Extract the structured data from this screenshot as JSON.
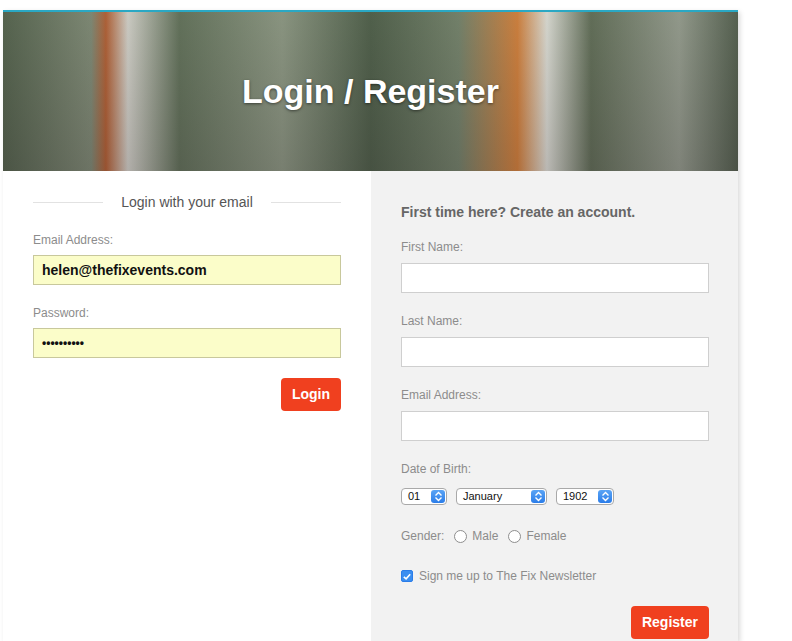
{
  "header": {
    "title": "Login / Register"
  },
  "login": {
    "heading": "Login with your email",
    "fields": [
      {
        "label": "Email Address:",
        "value": "helen@thefixevents.com",
        "kind": "text"
      },
      {
        "label": "Password:",
        "value": "••••••••••",
        "kind": "password"
      }
    ],
    "button": "Login"
  },
  "register": {
    "heading": "First time here? Create an account.",
    "fields": [
      {
        "label": "First Name:",
        "value": ""
      },
      {
        "label": "Last Name:",
        "value": ""
      },
      {
        "label": "Email Address:",
        "value": ""
      }
    ],
    "dob": {
      "label": "Date of Birth:",
      "day": "01",
      "month": "January",
      "year": "1902"
    },
    "gender": {
      "label": "Gender:",
      "options": [
        {
          "label": "Male",
          "selected": false
        },
        {
          "label": "Female",
          "selected": false
        }
      ]
    },
    "newsletter": {
      "label": "Sign me up to The Fix Newsletter",
      "checked": true
    },
    "button": "Register"
  }
}
